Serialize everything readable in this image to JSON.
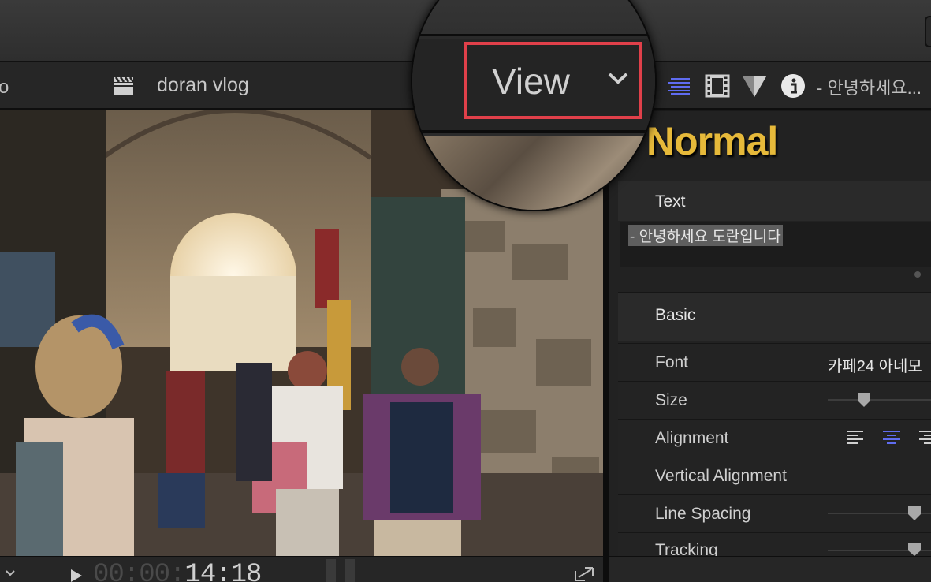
{
  "viewer": {
    "clipped_text": "o",
    "project_name": "doran vlog",
    "timecode_dim": "00:00:",
    "timecode_lit": "14:18"
  },
  "magnifier": {
    "view_label": "View",
    "highlight_color": "#e0404a"
  },
  "inspector": {
    "header_title": "- 안녕하세요...",
    "header_tabs": [
      "text-lines-icon",
      "film-icon",
      "triangle-icon",
      "info-icon"
    ],
    "preview_text": "Normal",
    "preview_color": "#e6b93a",
    "text_section_label": "Text",
    "text_value": "- 안녕하세요 도란입니다",
    "basic_section_label": "Basic",
    "params": {
      "font_label": "Font",
      "font_value": "카페24 아네모",
      "size_label": "Size",
      "alignment_label": "Alignment",
      "vertical_alignment_label": "Vertical Alignment",
      "line_spacing_label": "Line Spacing",
      "tracking_label": "Tracking"
    },
    "accent_color": "#5f6cf0"
  }
}
